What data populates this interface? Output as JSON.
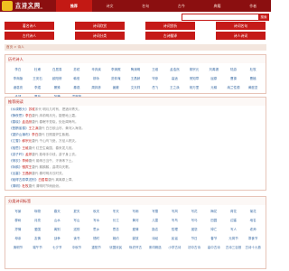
{
  "site": {
    "logo_title": "古诗文网",
    "logo_url_text": "www.shangshiwen.com"
  },
  "nav": {
    "items": [
      "推荐",
      "诗文",
      "名句",
      "古今",
      "典籍",
      "作者"
    ],
    "active_index": 0
  },
  "search": {
    "button": "搜索",
    "value": ""
  },
  "categories": [
    "著名诗人",
    "诗词欣赏",
    "诗词赏析",
    "诗词名句",
    "古代诗人",
    "诗词分类",
    "古诗翻译",
    "诗人诗词"
  ],
  "breadcrumb": "首页 > 诗人",
  "poets_box": {
    "title": "历代诗人",
    "items": [
      "李白",
      "杜甫",
      "白居易",
      "苏轼",
      "辛弃疾",
      "李清照",
      "陶渊明",
      "王维",
      "孟浩然",
      "柳宗元",
      "刘禹锡",
      "陆游",
      "杜牧",
      "李商隐",
      "王安石",
      "欧阳修",
      "韩愈",
      "柳永",
      "范仲淹",
      "王昌龄",
      "岑参",
      "高适",
      "贺知章",
      "屈原",
      "曹操",
      "曹植",
      "诸葛亮",
      "李煜",
      "晏殊",
      "秦观",
      "周邦彦",
      "姜夔",
      "文天祥",
      "岳飞",
      "王之涣",
      "杨万里",
      "元稹",
      "纳兰性德",
      "黄庭坚",
      "孟郊",
      "贾岛",
      "张籍",
      "温庭筠"
    ]
  },
  "recommend_box": {
    "title": "推荐阅读",
    "rows": [
      {
        "title": "《水调歌头》",
        "author": "苏轼",
        "desc": "宋代 明月几时有，把酒问青天。"
      },
      {
        "title": "《静夜思》",
        "author": "李白",
        "desc": "唐代 床前明月光，疑是地上霜。"
      },
      {
        "title": "《春晓》",
        "author": "孟浩然",
        "desc": "唐代 春眠不觉晓，处处闻啼鸟。"
      },
      {
        "title": "《登鹳雀楼》",
        "author": "王之涣",
        "desc": "唐代 白日依山尽，黄河入海流。"
      },
      {
        "title": "《望庐山瀑布》",
        "author": "李白",
        "desc": "唐代 日照香炉生紫烟。"
      },
      {
        "title": "《江雪》",
        "author": "柳宗元",
        "desc": "唐代 千山鸟飞绝，万径人踪灭。"
      },
      {
        "title": "《相思》",
        "author": "王维",
        "desc": "唐代 红豆生南国，春来发几枝。"
      },
      {
        "title": "《游子吟》",
        "author": "孟郊",
        "desc": "唐代 慈母手中线，游子身上衣。"
      },
      {
        "title": "《悯农》",
        "author": "李绅",
        "desc": "唐代 锄禾日当午，汗滴禾下土。"
      },
      {
        "title": "《咏鹅》",
        "author": "骆宾王",
        "desc": "唐代 鹅鹅鹅，曲项向天歌。"
      },
      {
        "title": "《出塞》",
        "author": "王昌龄",
        "desc": "唐代 秦时明月汉时关。"
      },
      {
        "title": "《赋得古原草送别》",
        "author": "白居易",
        "desc": "唐代 离离原上草。"
      },
      {
        "title": "《清明》",
        "author": "杜牧",
        "desc": "唐代 清明时节雨纷纷。"
      }
    ]
  },
  "tags_box": {
    "title": "分类诗词标签",
    "items": [
      "写景",
      "咏物",
      "春天",
      "夏天",
      "秋天",
      "冬天",
      "写雨",
      "写雪",
      "写风",
      "写花",
      "梅花",
      "荷花",
      "菊花",
      "柳树",
      "月亮",
      "山水",
      "写山",
      "写水",
      "长江",
      "黄河",
      "儿童",
      "写鸟",
      "写马",
      "田园",
      "边塞",
      "地名",
      "抒情",
      "爱国",
      "离别",
      "送别",
      "思乡",
      "思念",
      "爱情",
      "励志",
      "哲理",
      "闺怨",
      "悼亡",
      "写人",
      "老师",
      "母亲",
      "友情",
      "战争",
      "读书",
      "惜时",
      "婉约",
      "豪放",
      "诗经",
      "民谣",
      "节日",
      "春节",
      "元宵节",
      "寒食节",
      "清明节",
      "端午节",
      "七夕节",
      "中秋节",
      "重阳节",
      "忧国忧民",
      "咏史怀古",
      "宋词精选",
      "小学古诗",
      "初中古诗",
      "高中古诗",
      "古诗三百首",
      "古诗十九首"
    ]
  },
  "colors": {
    "header": "#8b0f10",
    "accent": "#c51a18",
    "link": "#3e6ea6"
  }
}
